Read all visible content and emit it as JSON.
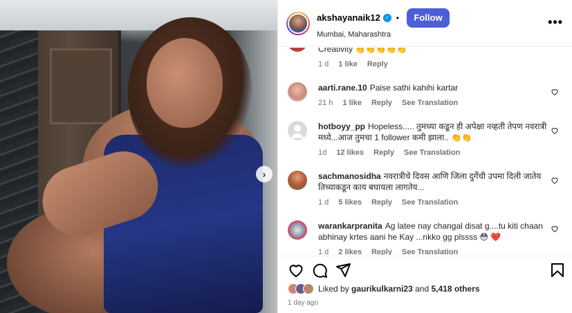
{
  "post": {
    "username": "akshayanaik12",
    "location": "Mumbai, Maharashtra",
    "follow_label": "Follow",
    "more_label": "•••",
    "next_label": "›"
  },
  "comments": [
    {
      "username": "",
      "text": "Creativity 👏👏👏👏👏",
      "time": "1 d",
      "likes": "1 like",
      "reply": "Reply",
      "translation": ""
    },
    {
      "username": "aarti.rane.10",
      "text": "Paise sathi kahihi kartar",
      "time": "21 h",
      "likes": "1 like",
      "reply": "Reply",
      "translation": "See Translation"
    },
    {
      "username": "hotboyy_pp",
      "text": "Hopeless..... तुमच्या कडून ही अपेक्षा नव्हती तेपण नवरात्री मध्ये...आज तुमचा 1 follower कमी झाला.. 👏👏",
      "time": "1d",
      "likes": "12 likes",
      "reply": "Reply",
      "translation": "See Translation"
    },
    {
      "username": "sachmanosidha",
      "text": "नवरात्रीचे दिवस आणि जिला दुर्गेची उपमा दिली जातेय तिच्याकडून काय बघायला लागतेय...",
      "time": "1 d",
      "likes": "5 likes",
      "reply": "Reply",
      "translation": "See Translation"
    },
    {
      "username": "warankarpranita",
      "text": "Ag latee nay changal disat g....tu kiti chaan abhinay krtes aani he Kay ...nkko gg plssss 😳 ❤️",
      "time": "1 d",
      "likes": "2 likes",
      "reply": "Reply",
      "translation": "See Translation"
    }
  ],
  "footer": {
    "liked_by_prefix": "Liked by",
    "liked_by_user": "gaurikulkarni23",
    "and": "and",
    "others": "5,418 others",
    "date": "1 day ago"
  },
  "colors": {
    "follow_bg": "#4c5fd7",
    "verified": "#0095f6",
    "meta": "#737373"
  },
  "icons": [
    "verified-icon",
    "heart-icon",
    "comment-icon",
    "share-icon",
    "save-icon",
    "more-icon",
    "next-arrow-icon"
  ]
}
